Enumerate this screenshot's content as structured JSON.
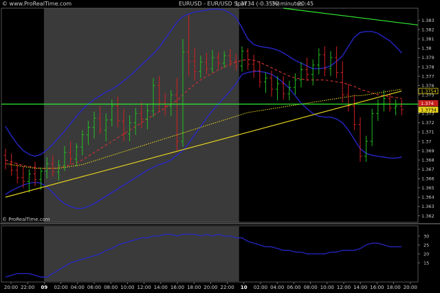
{
  "header": {
    "brand": "© www.ProRealTime.com",
    "symbol": "EURUSD - EUR/USD Spot",
    "last_change": "1.3734 (-0.35%)",
    "timeframe": "30 minutes",
    "clock": "20:45",
    "watermark": "© ProRealTime.com"
  },
  "colors": {
    "background": "#000000",
    "shade_session": "#3a3a3a",
    "candle_up": "#22c022",
    "candle_down": "#d42020",
    "bollinger": "#2626c8",
    "sma": "#c83232",
    "ema": "#e6d21e",
    "trendline_green": "#33ee33",
    "trendline_yellow": "#e6d21e",
    "indicator": "#2626c8"
  },
  "chart_data": [
    {
      "type": "candlestick",
      "title": "EURUSD - EUR/USD Spot",
      "timeframe": "30 minutes",
      "x_tick_labels": [
        "20:00",
        "22:00",
        "09",
        "02:00",
        "04:00",
        "06:00",
        "08:00",
        "10:00",
        "12:00",
        "14:00",
        "16:00",
        "18:00",
        "20:00",
        "22:00",
        "10",
        "02:00",
        "04:00",
        "06:00",
        "08:00",
        "10:00",
        "12:00",
        "14:00",
        "16:00",
        "18:00",
        "20:00"
      ],
      "x_tick_bold": [
        "09",
        "10"
      ],
      "y_tick_labels": [
        "1.383",
        "1.382",
        "1.381",
        "1.38",
        "1.379",
        "1.378",
        "1.377",
        "1.376",
        "1.375",
        "1.374",
        "1.373",
        "1.372",
        "1.371",
        "1.37",
        "1.369",
        "1.368",
        "1.367",
        "1.366",
        "1.365",
        "1.364",
        "1.363",
        "1.362"
      ],
      "ylim": [
        1.3613,
        1.3843
      ],
      "price_badges": [
        {
          "label": "1.3754",
          "value": 1.3754,
          "style": "outline"
        },
        {
          "label": "1.3734",
          "value": 1.3734,
          "style": "filled"
        },
        {
          "label": "1.374",
          "value": 1.3741,
          "style": "red"
        }
      ],
      "session_shading": [
        {
          "from_bar": 7,
          "to_bar": 39
        }
      ],
      "candles": [
        {
          "o": 1.3685,
          "h": 1.3692,
          "l": 1.367,
          "c": 1.3676
        },
        {
          "o": 1.3676,
          "h": 1.3687,
          "l": 1.3663,
          "c": 1.3669
        },
        {
          "o": 1.3669,
          "h": 1.3676,
          "l": 1.3655,
          "c": 1.3661
        },
        {
          "o": 1.3661,
          "h": 1.3673,
          "l": 1.365,
          "c": 1.3657
        },
        {
          "o": 1.3657,
          "h": 1.367,
          "l": 1.3645,
          "c": 1.3665
        },
        {
          "o": 1.3665,
          "h": 1.3678,
          "l": 1.3652,
          "c": 1.3659
        },
        {
          "o": 1.3659,
          "h": 1.3672,
          "l": 1.3648,
          "c": 1.3668
        },
        {
          "o": 1.3668,
          "h": 1.3683,
          "l": 1.366,
          "c": 1.3676
        },
        {
          "o": 1.3676,
          "h": 1.3685,
          "l": 1.3662,
          "c": 1.3667
        },
        {
          "o": 1.3667,
          "h": 1.368,
          "l": 1.3658,
          "c": 1.3674
        },
        {
          "o": 1.3674,
          "h": 1.3695,
          "l": 1.3668,
          "c": 1.3688
        },
        {
          "o": 1.3688,
          "h": 1.37,
          "l": 1.3675,
          "c": 1.3681
        },
        {
          "o": 1.3681,
          "h": 1.3698,
          "l": 1.3673,
          "c": 1.3694
        },
        {
          "o": 1.3694,
          "h": 1.3712,
          "l": 1.3685,
          "c": 1.3707
        },
        {
          "o": 1.3707,
          "h": 1.3722,
          "l": 1.3696,
          "c": 1.3715
        },
        {
          "o": 1.3715,
          "h": 1.3732,
          "l": 1.3703,
          "c": 1.3725
        },
        {
          "o": 1.3725,
          "h": 1.3738,
          "l": 1.3708,
          "c": 1.3712
        },
        {
          "o": 1.3712,
          "h": 1.373,
          "l": 1.37,
          "c": 1.3723
        },
        {
          "o": 1.3723,
          "h": 1.3745,
          "l": 1.3716,
          "c": 1.3738
        },
        {
          "o": 1.3738,
          "h": 1.3748,
          "l": 1.3715,
          "c": 1.3722
        },
        {
          "o": 1.3722,
          "h": 1.3735,
          "l": 1.37,
          "c": 1.3708
        },
        {
          "o": 1.3708,
          "h": 1.3728,
          "l": 1.37,
          "c": 1.372
        },
        {
          "o": 1.372,
          "h": 1.3736,
          "l": 1.3707,
          "c": 1.373
        },
        {
          "o": 1.373,
          "h": 1.3742,
          "l": 1.3714,
          "c": 1.3724
        },
        {
          "o": 1.3724,
          "h": 1.374,
          "l": 1.3713,
          "c": 1.3733
        },
        {
          "o": 1.3733,
          "h": 1.3768,
          "l": 1.3726,
          "c": 1.376
        },
        {
          "o": 1.376,
          "h": 1.377,
          "l": 1.3732,
          "c": 1.3742
        },
        {
          "o": 1.3742,
          "h": 1.3752,
          "l": 1.3728,
          "c": 1.3738
        },
        {
          "o": 1.3738,
          "h": 1.3755,
          "l": 1.3727,
          "c": 1.375
        },
        {
          "o": 1.375,
          "h": 1.3768,
          "l": 1.369,
          "c": 1.37
        },
        {
          "o": 1.37,
          "h": 1.381,
          "l": 1.3694,
          "c": 1.3796
        },
        {
          "o": 1.3796,
          "h": 1.3836,
          "l": 1.377,
          "c": 1.3786
        },
        {
          "o": 1.3786,
          "h": 1.38,
          "l": 1.3765,
          "c": 1.3775
        },
        {
          "o": 1.3775,
          "h": 1.3792,
          "l": 1.3768,
          "c": 1.3785
        },
        {
          "o": 1.3785,
          "h": 1.3795,
          "l": 1.3772,
          "c": 1.3778
        },
        {
          "o": 1.3778,
          "h": 1.3798,
          "l": 1.3774,
          "c": 1.379
        },
        {
          "o": 1.379,
          "h": 1.3796,
          "l": 1.3778,
          "c": 1.3784
        },
        {
          "o": 1.3784,
          "h": 1.3797,
          "l": 1.3779,
          "c": 1.3792
        },
        {
          "o": 1.3792,
          "h": 1.3799,
          "l": 1.378,
          "c": 1.3786
        },
        {
          "o": 1.3786,
          "h": 1.3794,
          "l": 1.3776,
          "c": 1.3781
        },
        {
          "o": 1.3781,
          "h": 1.3802,
          "l": 1.3775,
          "c": 1.3797
        },
        {
          "o": 1.3797,
          "h": 1.38,
          "l": 1.3777,
          "c": 1.3783
        },
        {
          "o": 1.3783,
          "h": 1.3793,
          "l": 1.3768,
          "c": 1.3776
        },
        {
          "o": 1.3776,
          "h": 1.3786,
          "l": 1.3758,
          "c": 1.3764
        },
        {
          "o": 1.3764,
          "h": 1.3774,
          "l": 1.3752,
          "c": 1.3768
        },
        {
          "o": 1.3768,
          "h": 1.3776,
          "l": 1.3748,
          "c": 1.3756
        },
        {
          "o": 1.3756,
          "h": 1.377,
          "l": 1.3744,
          "c": 1.3762
        },
        {
          "o": 1.3762,
          "h": 1.377,
          "l": 1.3745,
          "c": 1.3751
        },
        {
          "o": 1.3751,
          "h": 1.3765,
          "l": 1.3744,
          "c": 1.3758
        },
        {
          "o": 1.3758,
          "h": 1.3773,
          "l": 1.375,
          "c": 1.3766
        },
        {
          "o": 1.3766,
          "h": 1.3785,
          "l": 1.3758,
          "c": 1.3777
        },
        {
          "o": 1.3777,
          "h": 1.379,
          "l": 1.3765,
          "c": 1.3772
        },
        {
          "o": 1.3772,
          "h": 1.3788,
          "l": 1.376,
          "c": 1.3782
        },
        {
          "o": 1.3782,
          "h": 1.38,
          "l": 1.3772,
          "c": 1.3793
        },
        {
          "o": 1.3793,
          "h": 1.3802,
          "l": 1.377,
          "c": 1.3778
        },
        {
          "o": 1.3778,
          "h": 1.3797,
          "l": 1.377,
          "c": 1.379
        },
        {
          "o": 1.379,
          "h": 1.3802,
          "l": 1.3768,
          "c": 1.3774
        },
        {
          "o": 1.3774,
          "h": 1.3786,
          "l": 1.3742,
          "c": 1.375
        },
        {
          "o": 1.375,
          "h": 1.3762,
          "l": 1.3732,
          "c": 1.3738
        },
        {
          "o": 1.3738,
          "h": 1.375,
          "l": 1.3712,
          "c": 1.3718
        },
        {
          "o": 1.3718,
          "h": 1.3726,
          "l": 1.3678,
          "c": 1.3684
        },
        {
          "o": 1.3684,
          "h": 1.3706,
          "l": 1.3678,
          "c": 1.37
        },
        {
          "o": 1.37,
          "h": 1.3735,
          "l": 1.3695,
          "c": 1.373
        },
        {
          "o": 1.373,
          "h": 1.3745,
          "l": 1.3722,
          "c": 1.374
        },
        {
          "o": 1.374,
          "h": 1.3755,
          "l": 1.3732,
          "c": 1.3746
        },
        {
          "o": 1.3746,
          "h": 1.3752,
          "l": 1.3732,
          "c": 1.3736
        },
        {
          "o": 1.3736,
          "h": 1.3745,
          "l": 1.3728,
          "c": 1.3738
        },
        {
          "o": 1.3738,
          "h": 1.3745,
          "l": 1.3728,
          "c": 1.3734
        }
      ],
      "overlays": [
        {
          "name": "Bollinger upper",
          "kind": "line",
          "values": [
            1.3716,
            1.3706,
            1.3697,
            1.369,
            1.3686,
            1.3684,
            1.3686,
            1.3691,
            1.3697,
            1.3704,
            1.3711,
            1.3719,
            1.3727,
            1.3734,
            1.374,
            1.3745,
            1.3749,
            1.3753,
            1.3756,
            1.376,
            1.3765,
            1.377,
            1.3776,
            1.3782,
            1.3788,
            1.3794,
            1.3801,
            1.381,
            1.3819,
            1.3828,
            1.3834,
            1.3837,
            1.3839,
            1.384,
            1.3841,
            1.3842,
            1.3842,
            1.3841,
            1.3838,
            1.3833,
            1.3822,
            1.381,
            1.3804,
            1.3802,
            1.3801,
            1.38,
            1.3798,
            1.3795,
            1.3791,
            1.3787,
            1.3784,
            1.3781,
            1.3778,
            1.3778,
            1.3779,
            1.3781,
            1.3786,
            1.3792,
            1.3802,
            1.3812,
            1.3817,
            1.3818,
            1.3818,
            1.3816,
            1.3812,
            1.3808,
            1.3802,
            1.3795
          ]
        },
        {
          "name": "Bollinger lower",
          "kind": "line",
          "values": [
            1.3643,
            1.3647,
            1.365,
            1.3653,
            1.3655,
            1.3656,
            1.3655,
            1.3651,
            1.3645,
            1.3638,
            1.3633,
            1.363,
            1.3628,
            1.3628,
            1.363,
            1.3633,
            1.3637,
            1.3641,
            1.3645,
            1.3649,
            1.3653,
            1.3657,
            1.3661,
            1.3665,
            1.3669,
            1.3672,
            1.3675,
            1.3677,
            1.368,
            1.3685,
            1.369,
            1.3698,
            1.3707,
            1.3716,
            1.3725,
            1.3733,
            1.374,
            1.3747,
            1.3754,
            1.3762,
            1.3772,
            1.3774,
            1.3775,
            1.3775,
            1.3774,
            1.3772,
            1.3768,
            1.3763,
            1.3757,
            1.3749,
            1.3741,
            1.3735,
            1.373,
            1.3727,
            1.3726,
            1.3726,
            1.3724,
            1.372,
            1.3712,
            1.3702,
            1.3692,
            1.3687,
            1.3685,
            1.3684,
            1.3683,
            1.3682,
            1.3682,
            1.3683
          ]
        },
        {
          "name": "Moving average 1",
          "kind": "dashed",
          "values": [
            1.368,
            1.3678,
            1.3676,
            1.3674,
            1.3673,
            1.3672,
            1.3671,
            1.3671,
            1.3671,
            1.3672,
            1.3673,
            1.3675,
            1.3677,
            1.368,
            1.3684,
            1.3688,
            1.3692,
            1.3696,
            1.37,
            1.3704,
            1.3708,
            1.3712,
            1.3716,
            1.372,
            1.3724,
            1.3728,
            1.3732,
            1.3736,
            1.374,
            1.3744,
            1.375,
            1.3756,
            1.3761,
            1.3766,
            1.377,
            1.3773,
            1.3777,
            1.378,
            1.3783,
            1.3785,
            1.3787,
            1.3788,
            1.3787,
            1.3785,
            1.3782,
            1.3779,
            1.3776,
            1.3773,
            1.377,
            1.3768,
            1.3767,
            1.3766,
            1.3766,
            1.3766,
            1.3766,
            1.3765,
            1.3764,
            1.3763,
            1.3761,
            1.3759,
            1.3756,
            1.3754,
            1.3752,
            1.375,
            1.3749,
            1.3748,
            1.3747,
            1.3746
          ]
        },
        {
          "name": "Moving average 2",
          "kind": "dotted",
          "values": [
            1.3676,
            1.3675,
            1.3674,
            1.3673,
            1.3672,
            1.3671,
            1.3671,
            1.3671,
            1.3671,
            1.3671,
            1.3672,
            1.3673,
            1.3674,
            1.3675,
            1.3677,
            1.3679,
            1.3681,
            1.3683,
            1.3685,
            1.3687,
            1.3689,
            1.3691,
            1.3693,
            1.3695,
            1.3697,
            1.3699,
            1.3701,
            1.3703,
            1.3705,
            1.3707,
            1.3709,
            1.3711,
            1.3713,
            1.3715,
            1.3717,
            1.3719,
            1.3721,
            1.3723,
            1.3725,
            1.3727,
            1.3729,
            1.3731,
            1.3732,
            1.3733,
            1.3734,
            1.3735,
            1.3736,
            1.3737,
            1.3738,
            1.3739,
            1.374,
            1.3741,
            1.3742,
            1.3743,
            1.3744,
            1.3745,
            1.3746,
            1.3747,
            1.3748,
            1.3749,
            1.3749,
            1.375,
            1.3751,
            1.3752,
            1.3753,
            1.3754,
            1.3755,
            1.3756
          ]
        }
      ],
      "trendlines": [
        {
          "name": "green horizontal",
          "from": [
            0,
            1.374
          ],
          "to": [
            67,
            1.374
          ]
        },
        {
          "name": "green descending",
          "from": [
            47,
            1.3843
          ],
          "to": [
            70,
            1.3825
          ]
        },
        {
          "name": "yellow rising",
          "from": [
            0,
            1.364
          ],
          "to": [
            67,
            1.3754
          ]
        }
      ]
    },
    {
      "type": "line",
      "series": [
        {
          "values": [
            7,
            8,
            9,
            9,
            9,
            8,
            7,
            7,
            9,
            11,
            13,
            15,
            16,
            17,
            18,
            19,
            20,
            22,
            23,
            25,
            26,
            27,
            28,
            29,
            29,
            30,
            30,
            31,
            31,
            30,
            31,
            31,
            31,
            30,
            31,
            30,
            31,
            30,
            30,
            29,
            29,
            27,
            26,
            25,
            24,
            24,
            23,
            22,
            22,
            21,
            21,
            20,
            20,
            20,
            20,
            21,
            21,
            22,
            22,
            22,
            23,
            25,
            26,
            26,
            25,
            24,
            24,
            24
          ]
        }
      ],
      "ylim": [
        5,
        35
      ],
      "y_tick_labels": [
        "30",
        "25",
        "20",
        "15"
      ]
    }
  ]
}
